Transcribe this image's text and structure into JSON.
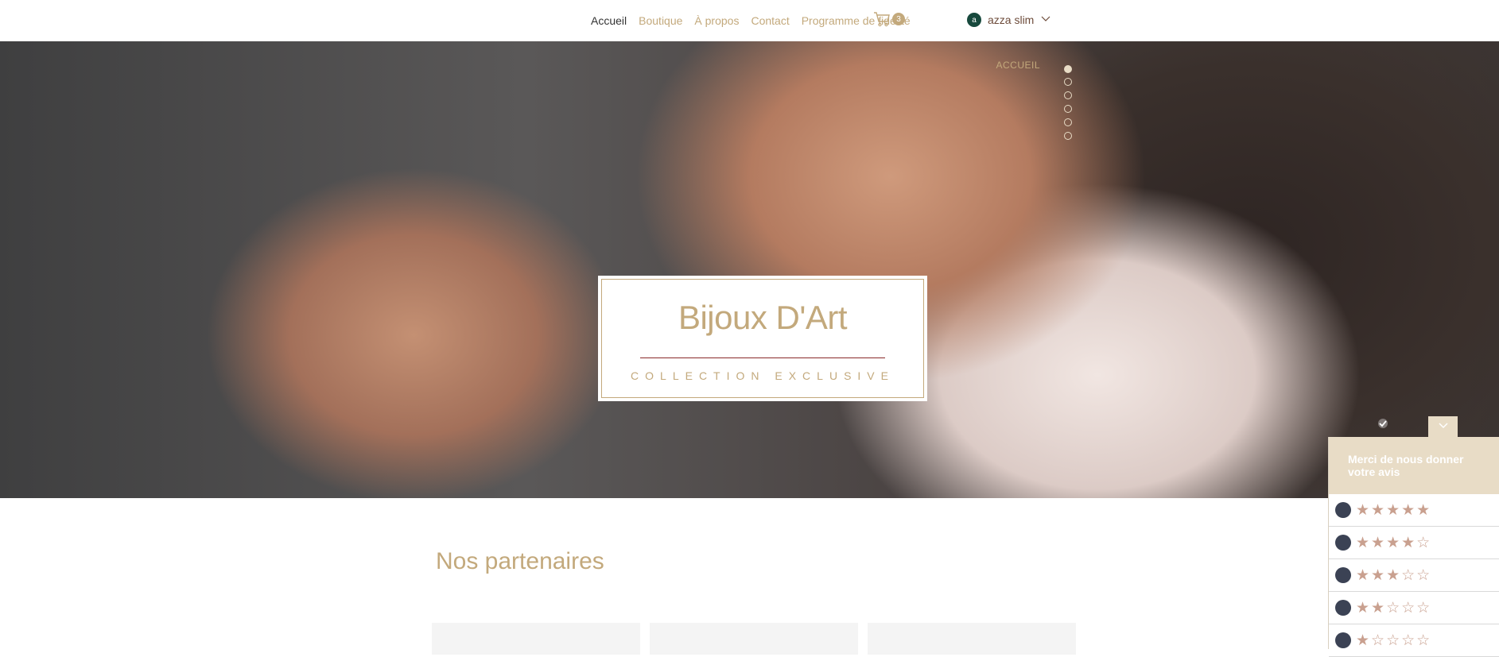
{
  "header": {
    "nav": [
      {
        "label": "Accueil",
        "active": true
      },
      {
        "label": "Boutique",
        "active": false
      },
      {
        "label": "À propos",
        "active": false
      },
      {
        "label": "Contact",
        "active": false
      },
      {
        "label": "Programme de fidélité",
        "active": false
      }
    ],
    "cart": {
      "icon": "cart-icon",
      "count": "3"
    },
    "user": {
      "avatar_letter": "a",
      "name": "azza slim",
      "icon": "chevron-down-icon"
    }
  },
  "hero": {
    "side_nav": {
      "active_label": "ACCUEIL",
      "dots": 6
    },
    "brand": {
      "title": "Bijoux D'Art",
      "subtitle": "COLLECTION EXCLUSIVE"
    }
  },
  "partners": {
    "title": "Nos partenaires"
  },
  "review": {
    "title": "Merci de nous donner votre avis",
    "options": [
      {
        "stars": "★★★★★"
      },
      {
        "stars": "★★★★☆"
      },
      {
        "stars": "★★★☆☆"
      },
      {
        "stars": "★★☆☆☆"
      },
      {
        "stars": "★☆☆☆☆"
      }
    ]
  },
  "colors": {
    "gold": "#c3a97c",
    "avatar": "#17493d",
    "beige": "#e8dcc6"
  }
}
